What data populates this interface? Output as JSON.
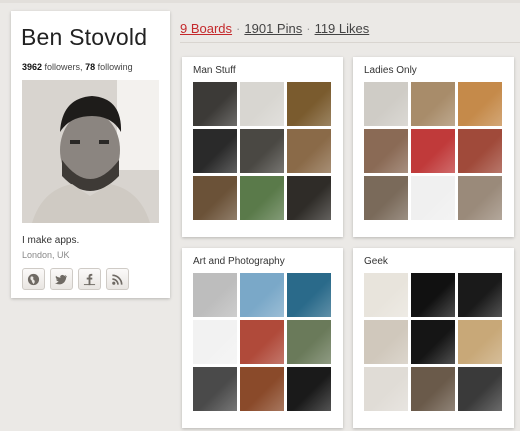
{
  "profile": {
    "name": "Ben Stovold",
    "followers_count": "3962",
    "followers_label": "followers,",
    "following_count": "78",
    "following_label": "following",
    "bio": "I make apps.",
    "location": "London, UK",
    "social_icons": [
      "globe-icon",
      "twitter-icon",
      "facebook-icon",
      "rss-icon"
    ]
  },
  "counts": {
    "boards": "9 Boards",
    "pins": "1901 Pins",
    "likes": "119 Likes",
    "separator": "·"
  },
  "colors": {
    "accent": "#c4282b",
    "background": "#ebe9e6",
    "card": "#ffffff"
  },
  "boards": [
    {
      "title": "Man Stuff",
      "thumbs": [
        "#3c3a37",
        "#d8d6d1",
        "#7a5b2e",
        "#2a2a2a",
        "#4a4843",
        "#8a6a48",
        "#6b5238",
        "#5a7a4a",
        "#2f2c28"
      ]
    },
    {
      "title": "Ladies Only",
      "thumbs": [
        "#cfccc6",
        "#a88c6a",
        "#c58a4a",
        "#8a6a55",
        "#c03a3a",
        "#a04a3a",
        "#7a6a5a",
        "#f0f0f0",
        "#9a8a7a"
      ]
    },
    {
      "title": "Art and Photography",
      "thumbs": [
        "#bdbdbd",
        "#7aa8c8",
        "#2a6a8a",
        "#f2f2f2",
        "#b04a3a",
        "#6a7a5a",
        "#4a4a4a",
        "#8a4a2a",
        "#1a1a1a"
      ]
    },
    {
      "title": "Geek",
      "thumbs": [
        "#e8e4dc",
        "#111111",
        "#1a1a1a",
        "#d0c8bc",
        "#151515",
        "#c8a878",
        "#e0dcd6",
        "#6a5a4a",
        "#3a3a3a"
      ]
    }
  ]
}
